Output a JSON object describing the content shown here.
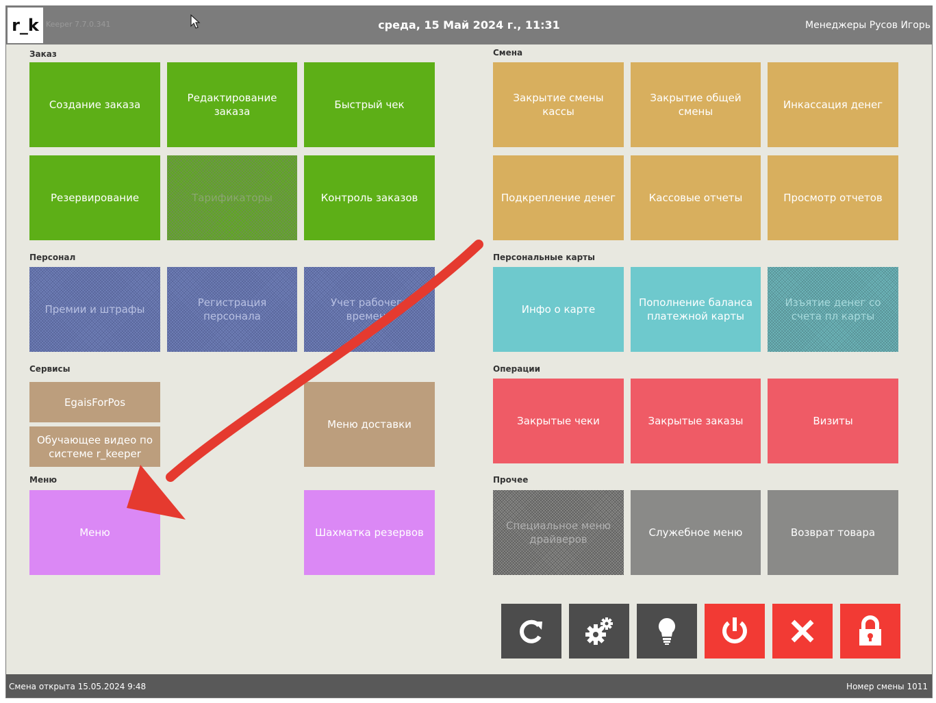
{
  "header": {
    "logo": "r_k",
    "version": "Keeper 7.7.0.341",
    "datetime": "среда, 15 Май 2024 г., 11:31",
    "user": "Менеджеры Русов Игорь"
  },
  "sections": {
    "order": {
      "title": "Заказ",
      "tiles": [
        "Создание заказа",
        "Редактирование заказа",
        "Быстрый чек",
        "Резервирование",
        "Тарификаторы",
        "Контроль заказов"
      ]
    },
    "shift": {
      "title": "Смена",
      "tiles": [
        "Закрытие смены кассы",
        "Закрытие общей смены",
        "Инкассация денег",
        "Подкрепление денег",
        "Кассовые отчеты",
        "Просмотр отчетов"
      ]
    },
    "staff": {
      "title": "Персонал",
      "tiles": [
        "Премии и штрафы",
        "Регистрация персонала",
        "Учет рабочего времени"
      ]
    },
    "cards": {
      "title": "Персональные карты",
      "tiles": [
        "Инфо о карте",
        "Пополнение баланса платежной карты",
        "Изъятие денег со счета пл карты"
      ]
    },
    "services": {
      "title": "Сервисы",
      "tiles": [
        "EgaisForPos",
        "Обучающее видео по системе r_keeper",
        "Меню доставки"
      ]
    },
    "operations": {
      "title": "Операции",
      "tiles": [
        "Закрытые чеки",
        "Закрытые заказы",
        "Визиты"
      ]
    },
    "menu": {
      "title": "Меню",
      "tiles": [
        "Меню",
        "Шахматка резервов"
      ]
    },
    "other": {
      "title": "Прочее",
      "tiles": [
        "Специальное меню драйверов",
        "Служебное меню",
        "Возврат товара"
      ]
    }
  },
  "toolbar": {
    "buttons": [
      "refresh-icon",
      "settings-icon",
      "lightbulb-icon",
      "power-icon",
      "close-icon",
      "lock-icon"
    ]
  },
  "status": {
    "shift_opened": "Смена открыта 15.05.2024 9:48",
    "shift_number": "Номер смены 1011"
  },
  "colors": {
    "topbar": "#7c7c7c",
    "background": "#e8e8e0",
    "green": "#5daf17",
    "orange": "#d8af5e",
    "blue": "#7080b8",
    "teal": "#6ec9cd",
    "brown": "#bc9e7d",
    "red": "#ef5b66",
    "violet": "#db88f5",
    "gray": "#8a8a88",
    "toolbar_dark": "#4c4c4c",
    "toolbar_red": "#f23a34",
    "annotation_arrow": "#e53a2f"
  }
}
